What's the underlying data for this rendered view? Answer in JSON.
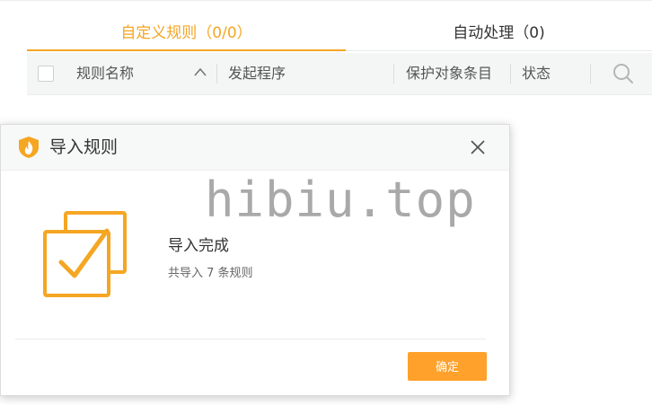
{
  "tabs": {
    "custom_label": "自定义规则（0/0）",
    "auto_label": "自动处理（0)"
  },
  "table": {
    "columns": {
      "rule_name": "规则名称",
      "initiator": "发起程序",
      "protected_object": "保护对象条目",
      "status": "状态"
    }
  },
  "dialog": {
    "title": "导入规则",
    "message_title": "导入完成",
    "message_detail": "共导入 7 条规则",
    "ok_label": "确定"
  },
  "watermark": "hibiu.top",
  "colors": {
    "accent": "#f5a623",
    "button": "#ffa12b",
    "header_bg": "#f4f6f6"
  },
  "icons": [
    "checkbox-icon",
    "sort-up-icon",
    "search-icon",
    "shield-flame-icon",
    "close-icon",
    "import-success-icon"
  ]
}
